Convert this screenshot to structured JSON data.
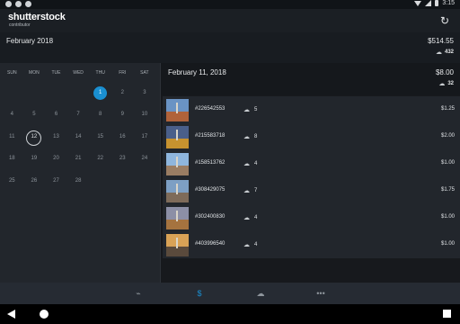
{
  "statusbar": {
    "time": "3:15"
  },
  "appbar": {
    "logo": "shutterstock",
    "logo_sub": "contributor",
    "refresh_icon": "refresh-icon"
  },
  "summary": {
    "month": "February 2018",
    "amount": "$514.55",
    "downloads": "432"
  },
  "calendar": {
    "weekdays": [
      "SUN",
      "MON",
      "TUE",
      "WED",
      "THU",
      "FRI",
      "SAT"
    ],
    "weeks": [
      [
        "",
        "",
        "",
        "",
        "1",
        "2",
        "3"
      ],
      [
        "4",
        "5",
        "6",
        "7",
        "8",
        "9",
        "10"
      ],
      [
        "11",
        "12",
        "13",
        "14",
        "15",
        "16",
        "17"
      ],
      [
        "18",
        "19",
        "20",
        "21",
        "22",
        "23",
        "24"
      ],
      [
        "25",
        "26",
        "27",
        "28",
        "",
        "",
        ""
      ]
    ],
    "selected_day": "1",
    "today": "12"
  },
  "detail": {
    "date": "February 11, 2018",
    "amount": "$8.00",
    "downloads": "32"
  },
  "photos": [
    {
      "id": "#226542553",
      "downloads": "5",
      "amount": "$1.25",
      "sky": "#6a93c4",
      "ground": "#b0623a"
    },
    {
      "id": "#215583718",
      "downloads": "8",
      "amount": "$2.00",
      "sky": "#4a5f8a",
      "ground": "#c7922f"
    },
    {
      "id": "#158513762",
      "downloads": "4",
      "amount": "$1.00",
      "sky": "#8fb6dd",
      "ground": "#9a7d63"
    },
    {
      "id": "#308429075",
      "downloads": "7",
      "amount": "$1.75",
      "sky": "#7d9fc4",
      "ground": "#7e6b5a"
    },
    {
      "id": "#302400830",
      "downloads": "4",
      "amount": "$1.00",
      "sky": "#8c8fa6",
      "ground": "#a5733f"
    },
    {
      "id": "#403996540",
      "downloads": "4",
      "amount": "$1.00",
      "sky": "#d9a256",
      "ground": "#5a4a3c"
    }
  ],
  "bottom_tabs": [
    {
      "name": "activity-tab",
      "icon": "pulse-icon",
      "glyph": "⌁",
      "active": false
    },
    {
      "name": "earnings-tab",
      "icon": "dollar-icon",
      "glyph": "$",
      "active": true
    },
    {
      "name": "uploads-tab",
      "icon": "cloud-upload-icon",
      "glyph": "☁",
      "active": false
    },
    {
      "name": "more-tab",
      "icon": "more-icon",
      "glyph": "•••",
      "active": false
    }
  ],
  "colors": {
    "accent": "#1a8fd1",
    "background": "#1f2329"
  }
}
